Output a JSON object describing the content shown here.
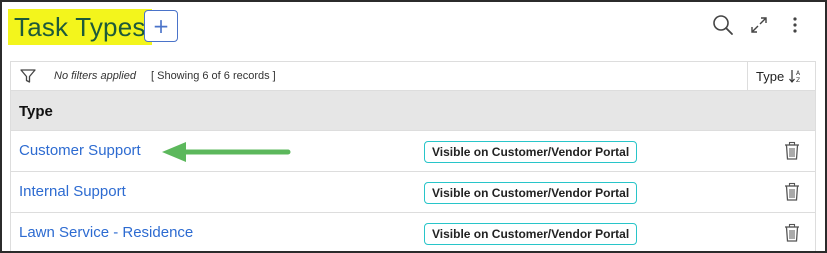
{
  "header": {
    "title": "Task Types",
    "add_label": "+"
  },
  "filter_bar": {
    "status": "No filters applied",
    "record_count": "[ Showing 6 of 6 records ]",
    "sort_label": "Type"
  },
  "table": {
    "column_header": "Type",
    "rows": [
      {
        "name": "Customer Support",
        "badge": "Visible on Customer/Vendor Portal"
      },
      {
        "name": "Internal Support",
        "badge": "Visible on Customer/Vendor Portal"
      },
      {
        "name": "Lawn Service - Residence",
        "badge": "Visible on Customer/Vendor Portal"
      }
    ]
  },
  "colors": {
    "title_highlight": "#f3f51c",
    "title_text": "#1d5a3a",
    "link": "#2d6bd1",
    "badge_border": "#28c5c9",
    "arrow": "#5cb85c"
  },
  "icons": {
    "add": "plus-icon",
    "search": "search-icon",
    "expand": "expand-icon",
    "menu": "vertical-dots-icon",
    "filter": "funnel-icon",
    "sort": "sort-az-icon",
    "delete": "trash-icon",
    "callout": "arrow-left-icon"
  }
}
